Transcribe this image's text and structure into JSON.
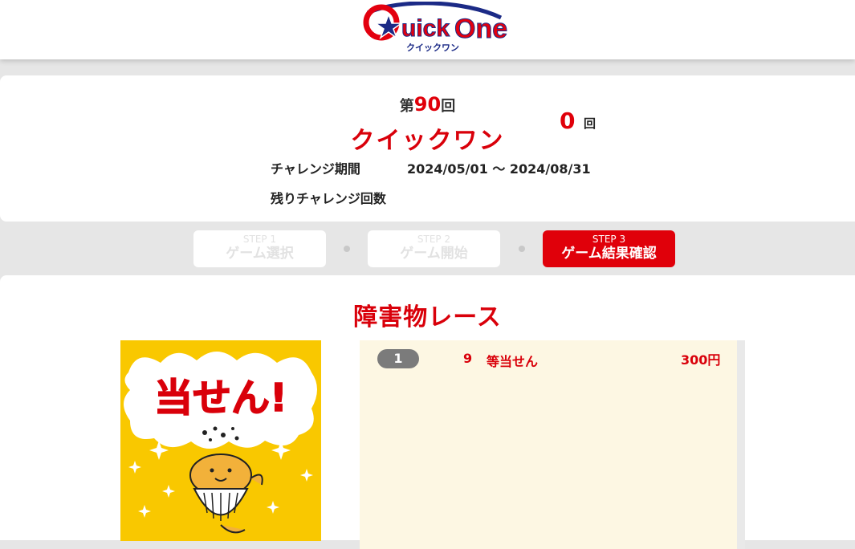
{
  "header": {
    "logo_main": "QuickOne",
    "logo_sub": "クイックワン"
  },
  "campaign": {
    "round_prefix": "第",
    "round_number": "90",
    "round_suffix": "回",
    "title": "クイックワン",
    "period_label": "チャレンジ期間",
    "period_value": "2024/05/01 ～ 2024/08/31",
    "remaining_label": "残りチャレンジ回数",
    "remaining_count": "0",
    "remaining_unit": "回"
  },
  "steps": [
    {
      "small": "STEP 1",
      "label": "ゲーム選択",
      "active": false
    },
    {
      "small": "STEP 2",
      "label": "ゲーム開始",
      "active": false
    },
    {
      "small": "STEP 3",
      "label": "ゲーム結果確認",
      "active": true
    }
  ],
  "game": {
    "title": "障害物レース",
    "image_text": "当せん!",
    "results": [
      {
        "index": "1",
        "rank": "9",
        "name": "等当せん",
        "amount": "300円"
      }
    ]
  },
  "colors": {
    "accent_red": "#e0000a",
    "result_bg": "#fdf7e3",
    "badge_gray": "#7b7b7b",
    "image_yellow": "#f9c800"
  }
}
